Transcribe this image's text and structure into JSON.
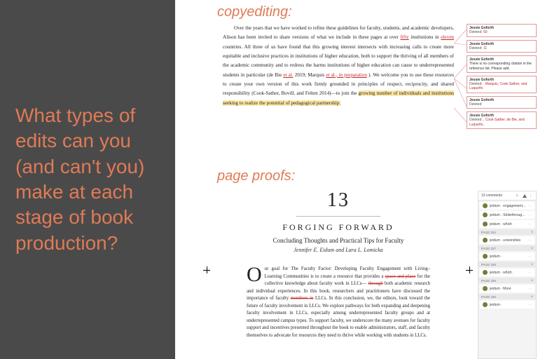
{
  "left": {
    "heading": "What types of edits can you (and can't you) make at each stage of book production?"
  },
  "labels": {
    "copyediting": "copyediting:",
    "proofs": "page proofs:"
  },
  "copyedit": {
    "body_pre": "Over the years that we have worked to refine these guidelines for faculty, students, and academic developers, Alison has been invited to share versions of what we include in these pages at over ",
    "mark1": "fifty",
    "body_mid1": " institutions in ",
    "mark2": "eleven",
    "body_mid2": " countries. All three of us have found that this growing interest intersects with increasing calls to create more equitable and inclusive practices in institutions of higher education, both to support the thriving of all members of the academic community and to redress the harms institutions of higher education can cause to underrepresented students in particular (de Bie ",
    "mark3": "et al.",
    "body_mid3": " 2019; Marquis ",
    "mark4": "et al., in preparation",
    "body_mid4": "). We welcome you to use these resources to create your own version of this work firmly grounded in principles of respect, reciprocity, and shared responsibility (Cook-Sather, Bovill, and Felten 2014)—to join the ",
    "hl": "growing number of individuals and institutions seeking to realize the potential of pedagogical partnership.",
    "comments": [
      {
        "who": "Jessie Goforth",
        "act": "Deleted:",
        "val": "50"
      },
      {
        "who": "Jessie Goforth",
        "act": "Deleted:",
        "val": "11"
      },
      {
        "who": "Jessie Goforth",
        "act": "",
        "val": "There is no corresponding citation in the reference list. Please add."
      },
      {
        "who": "Jessie Goforth",
        "act": "Deleted:",
        "val": ", Marquis, Cook-Sather, and Luqueño"
      },
      {
        "who": "Jessie Goforth",
        "act": "Deleted:",
        "val": " "
      },
      {
        "who": "Jessie Goforth",
        "act": "Deleted:",
        "val": ", Cook-Sather, de Bie, and Luqueño,"
      }
    ]
  },
  "proofs": {
    "chapter_number": "13",
    "title": "FORGING FORWARD",
    "subtitle": "Concluding Thoughts and Practical Tips for Faculty",
    "authors": "Jennifer E. Eidum and Lara L. Lomicka",
    "dropcap": "O",
    "body_pre": "ur goal for The Faculty Factor: Developing Faculty Engagement with Living–Learning Communities is to create a resource that provides a ",
    "strike1": "space and place",
    "body_mid1": " for the collective knowledge about faculty work in LLCs—",
    "strike2": "through",
    "body_mid2": " both academic research and individual experiences. In this book, researchers and practitioners have discussed the importance of faculty ",
    "strike3": "members in",
    "body_end": " LLCs. In this conclusion, we, the editors, look toward the future of faculty involvement in LLCs. We explore pathways for both expanding and deepening faculty involvement in LLCs, especially among underrepresented faculty groups and at underrepresented campus types. To support faculty, we underscore the many avenues for faculty support and incentives presented throughout the book to enable administrators, staff, and faculty themselves to advocate for resources they need to thrive while working with students in LLCs."
  },
  "comments_panel": {
    "header": "13 comments",
    "groups": [
      {
        "page": "",
        "items": [
          "jeidum",
          "engagement with",
          "jeidum",
          "Strikethrough Text",
          "jeidum",
          "which"
        ]
      },
      {
        "page": "PAGE 324",
        "items": [
          "jeidum",
          "universities"
        ]
      },
      {
        "page": "PAGE 327",
        "items": [
          "jeidum"
        ]
      },
      {
        "page": "PAGE 328",
        "items": [
          "jeidum",
          "which"
        ]
      },
      {
        "page": "PAGE 329",
        "items": [
          "jeidum",
          "More"
        ]
      },
      {
        "page": "PAGE 330",
        "items": [
          "jeidum"
        ]
      }
    ]
  }
}
